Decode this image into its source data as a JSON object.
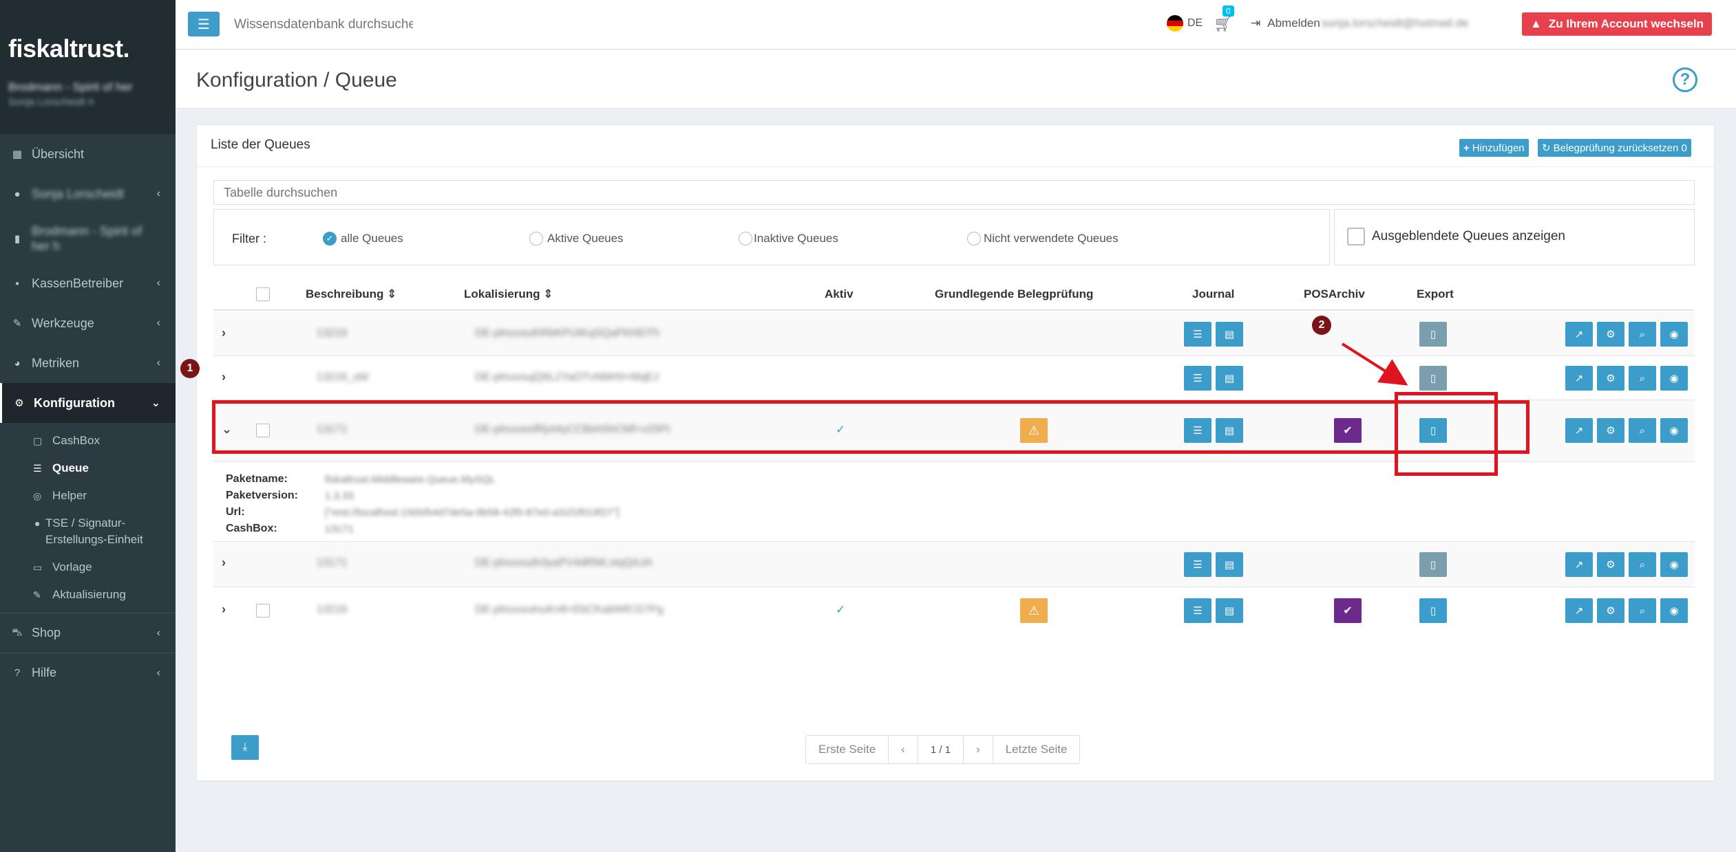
{
  "brand": {
    "logo": "fiskaltrust.",
    "user_line1": "Brodmann - Spirit of her",
    "user_line2": "Sonja Lorscheidt ≡"
  },
  "sidebar": {
    "items": [
      {
        "label": "Übersicht",
        "icon": "grid-icon"
      },
      {
        "label": "Sonja Lorscheidt",
        "icon": "user-icon",
        "blurred": true
      },
      {
        "label": "Brodmann - Spirit of her h",
        "icon": "building-icon",
        "blurred": true
      },
      {
        "label": "KassenBetreiber",
        "icon": "briefcase-icon"
      },
      {
        "label": "Werkzeuge",
        "icon": "wrench-icon"
      },
      {
        "label": "Metriken",
        "icon": "dashboard-icon"
      },
      {
        "label": "Konfiguration",
        "icon": "gears-icon"
      },
      {
        "label": "Shop",
        "icon": "basket-icon"
      },
      {
        "label": "Hilfe",
        "icon": "question-icon"
      }
    ],
    "subitems": [
      {
        "label": "CashBox",
        "icon": "box-icon"
      },
      {
        "label": "Queue",
        "icon": "database-icon"
      },
      {
        "label": "Helper",
        "icon": "lifebuoy-icon"
      },
      {
        "label": "TSE / Signatur-Erstellungs-Einheit",
        "icon": "dot-icon"
      },
      {
        "label": "Vorlage",
        "icon": "template-icon"
      },
      {
        "label": "Aktualisierung",
        "icon": "wrench-icon"
      }
    ]
  },
  "topbar": {
    "search_placeholder": "Wissensdatenbank durchsuchen",
    "language": "DE",
    "cart_count": "0",
    "logout_label": "Abmelden",
    "logout_email": "sonja.lorscheidt@hotmail.de",
    "switch_account": "Zu Ihrem Account wechseln"
  },
  "page": {
    "title": "Konfiguration / Queue"
  },
  "box": {
    "title": "Liste der Queues",
    "add_button": "Hinzufügen",
    "reset_button": "Belegprüfung zurücksetzen 0",
    "table_search_placeholder": "Tabelle durchsuchen",
    "filter_label": "Filter :",
    "filters": [
      "alle Queues",
      "Aktive Queues",
      "Inaktive Queues",
      "Nicht verwendete Queues"
    ],
    "show_hidden": "Ausgeblendete Queues anzeigen"
  },
  "table": {
    "headers": {
      "beschreibung": "Beschreibung ⇕",
      "lokalisierung": "Lokalisierung ⇕",
      "aktiv": "Aktiv",
      "belegpruefung": "Grundlegende Belegprüfung",
      "journal": "Journal",
      "posarchiv": "POSArchiv",
      "export": "Export"
    },
    "rows": [
      {
        "beschreibung": "13216",
        "lokalisierung": "DE-plnuvsuthRbKPUtKqSQaFKhlDTh"
      },
      {
        "beschreibung": "13216_old",
        "lokalisierung": "DE-plnuvsujQ6L2YaOTvNMrhl+MqEJ"
      },
      {
        "beschreibung": "13171",
        "lokalisierung": "DE-plnuvwsfRjvt4yCCBeh5hCMf+v25Pt"
      },
      {
        "beschreibung": "13171",
        "lokalisierung": "DE-plnuvsuth3yaPV4dRMt.xtqQAJA"
      },
      {
        "beschreibung": "13216",
        "lokalisierung": "DE-plnuvsutnuKn8+EbCKabWlCG7Pg"
      }
    ],
    "detail": {
      "labels": [
        "Paketname:",
        "Paketversion:",
        "Url:",
        "CashBox:"
      ],
      "values": [
        "fiskaltrust.Middleware.Queue.MySQL",
        "1.3.33",
        "[\"rest://localhost:1500/b4d7de5a-0b58-42f0-87e0-a31f1f019f27\"]",
        "13171"
      ]
    }
  },
  "pager": {
    "first": "Erste Seite",
    "prev": "‹",
    "page": "1 / 1",
    "next": "›",
    "last": "Letzte Seite"
  },
  "annotations": {
    "badge1": "1",
    "badge2": "2"
  }
}
